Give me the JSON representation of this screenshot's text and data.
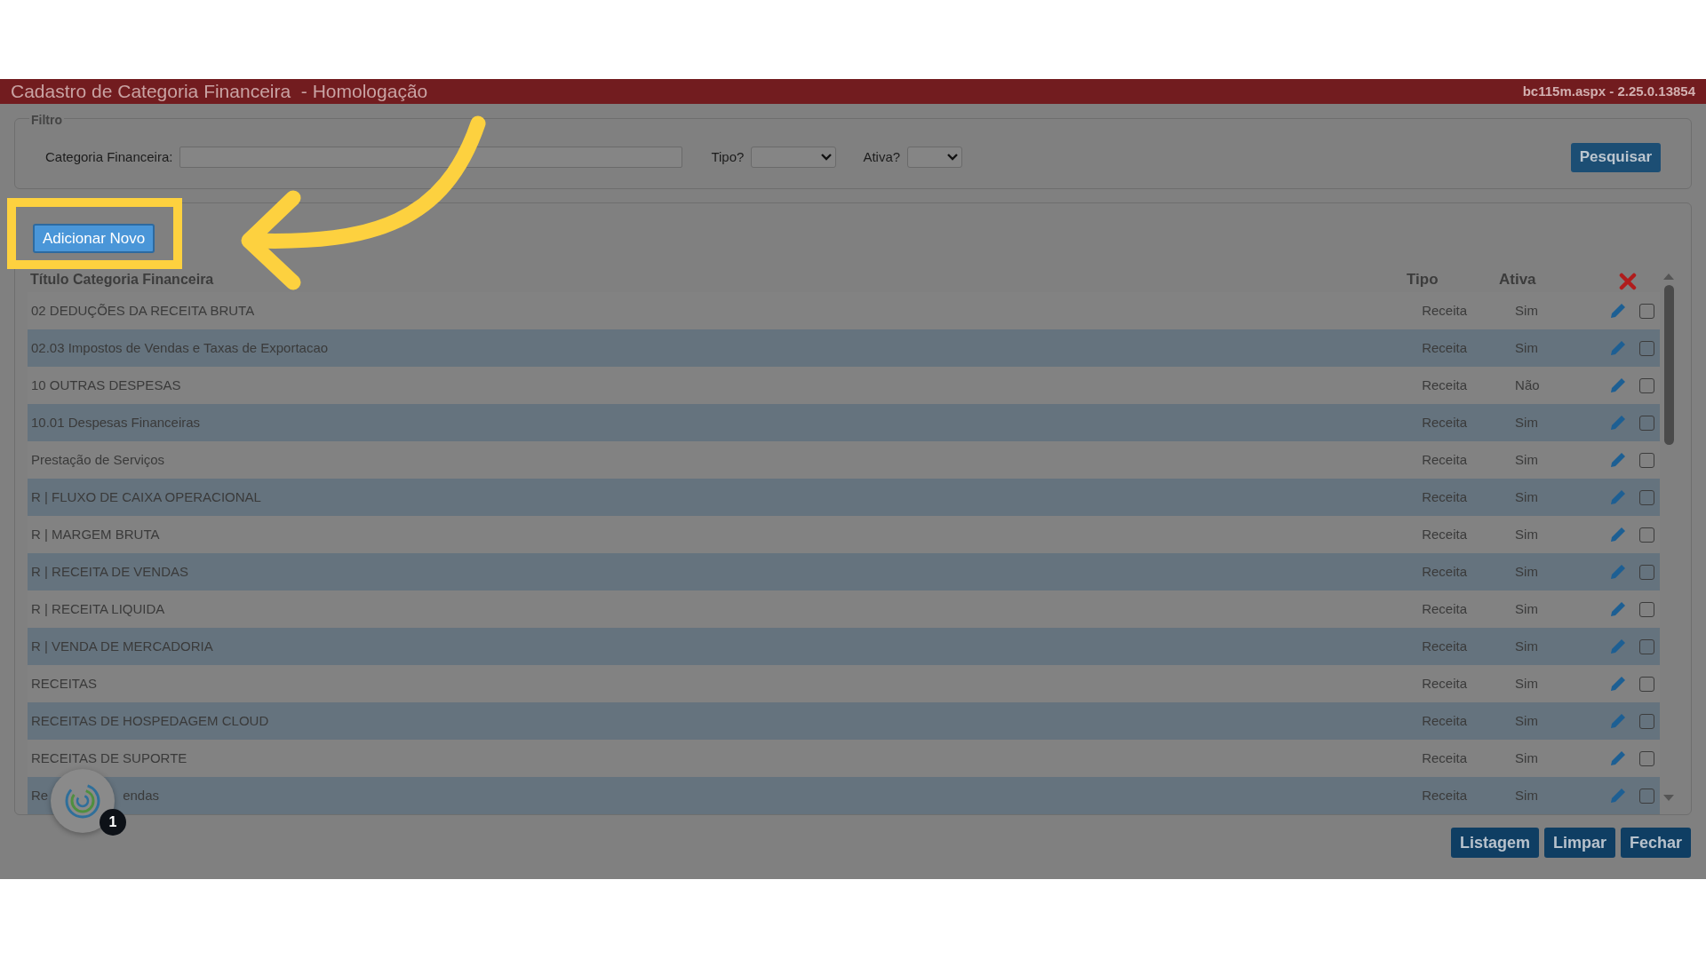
{
  "window": {
    "title": "Cadastro de Categoria Financeira  - Homologação",
    "version": "bc115m.aspx - 2.25.0.13854"
  },
  "filter": {
    "legend": "Filtro",
    "category_label": "Categoria Financeira:",
    "tipo_label": "Tipo?",
    "ativa_label": "Ativa?",
    "search_button": "Pesquisar"
  },
  "list": {
    "add_button": "Adicionar Novo",
    "columns": [
      "Título Categoria Financeira",
      "Tipo",
      "Ativa"
    ],
    "rows": [
      {
        "title": "02 DEDUÇÕES DA RECEITA BRUTA",
        "tipo": "Receita",
        "ativa": "Sim",
        "checked": false
      },
      {
        "title": "02.03 Impostos de Vendas e Taxas de Exportacao",
        "tipo": "Receita",
        "ativa": "Sim",
        "checked": false
      },
      {
        "title": "10 OUTRAS DESPESAS",
        "tipo": "Receita",
        "ativa": "Não",
        "checked": false
      },
      {
        "title": "10.01 Despesas Financeiras",
        "tipo": "Receita",
        "ativa": "Sim",
        "checked": false
      },
      {
        "title": "Prestação de Serviços",
        "tipo": "Receita",
        "ativa": "Sim",
        "checked": false
      },
      {
        "title": "R | FLUXO DE CAIXA OPERACIONAL",
        "tipo": "Receita",
        "ativa": "Sim",
        "checked": false
      },
      {
        "title": "R | MARGEM BRUTA",
        "tipo": "Receita",
        "ativa": "Sim",
        "checked": false
      },
      {
        "title": "R | RECEITA DE VENDAS",
        "tipo": "Receita",
        "ativa": "Sim",
        "checked": false
      },
      {
        "title": "R | RECEITA LIQUIDA",
        "tipo": "Receita",
        "ativa": "Sim",
        "checked": false
      },
      {
        "title": "R | VENDA DE MERCADORIA",
        "tipo": "Receita",
        "ativa": "Sim",
        "checked": false
      },
      {
        "title": "RECEITAS",
        "tipo": "Receita",
        "ativa": "Sim",
        "checked": false
      },
      {
        "title": "RECEITAS DE HOSPEDAGEM CLOUD",
        "tipo": "Receita",
        "ativa": "Sim",
        "checked": false
      },
      {
        "title": "RECEITAS DE SUPORTE",
        "tipo": "Receita",
        "ativa": "Sim",
        "checked": false
      },
      {
        "title": "Re",
        "title_after_widget": "endas",
        "tipo": "Receita",
        "ativa": "Sim",
        "checked": false
      }
    ]
  },
  "footer_buttons": [
    "Listagem",
    "Limpar",
    "Fechar"
  ],
  "chat_widget": {
    "badge": "1"
  }
}
